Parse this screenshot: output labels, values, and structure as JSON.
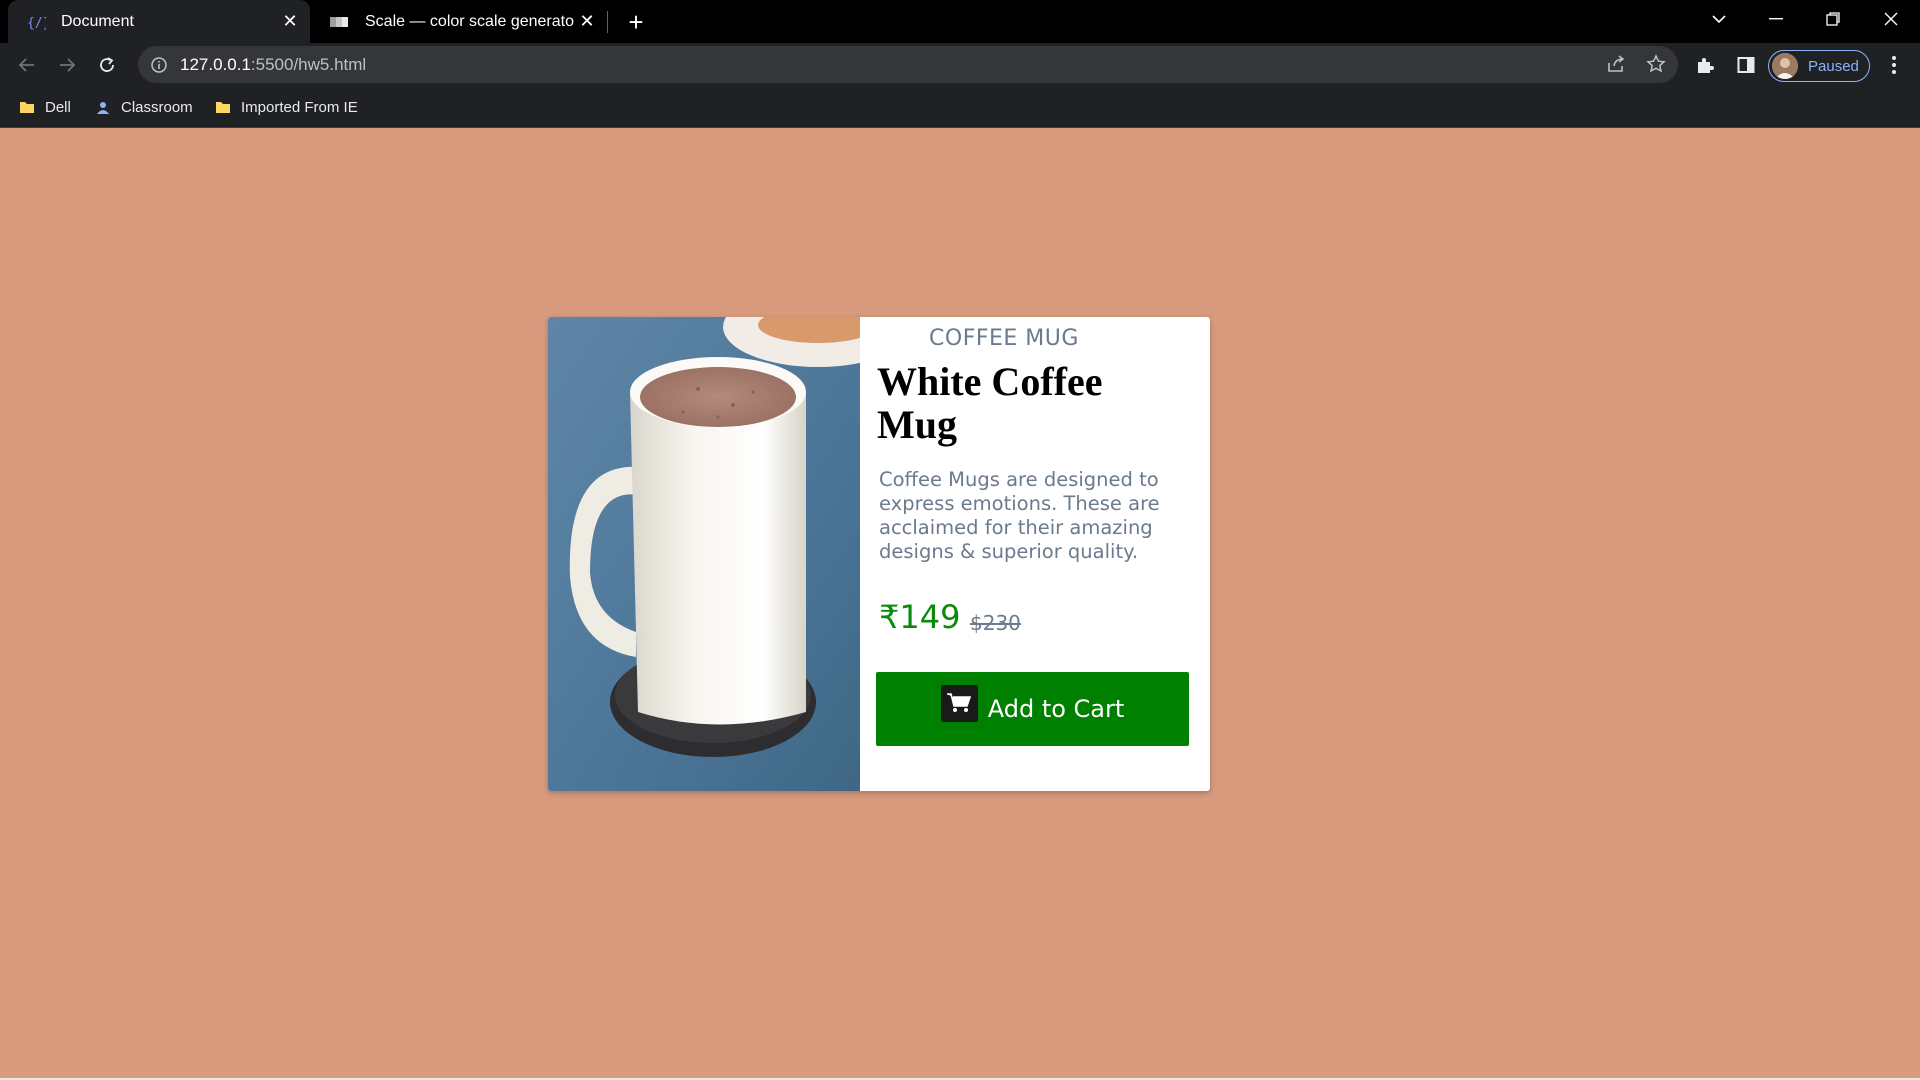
{
  "browser": {
    "tabs": [
      {
        "title": "Document",
        "active": true,
        "favicon": "code-brackets-icon"
      },
      {
        "title": "Scale — color scale generator",
        "active": false,
        "favicon": "scale-icon"
      }
    ],
    "url_host": "127.0.0.1",
    "url_path": ":5500/hw5.html",
    "profile_label": "Paused",
    "bookmarks": [
      {
        "label": "Dell",
        "icon": "folder-icon"
      },
      {
        "label": "Classroom",
        "icon": "classroom-icon"
      },
      {
        "label": "Imported From IE",
        "icon": "folder-icon"
      }
    ]
  },
  "page": {
    "background_color": "#d99b7e",
    "card": {
      "category": "COFFEE MUG",
      "title": "White Coffee Mug",
      "description": "Coffee Mugs are designed to express emotions. These are acclaimed for their amazing designs & superior quality.",
      "price_current": "₹149",
      "price_old": "$230",
      "button_label": "Add to Cart",
      "button_color": "#008000",
      "price_color": "#0a8a0a",
      "image_alt": "white coffee mug on coaster"
    }
  }
}
